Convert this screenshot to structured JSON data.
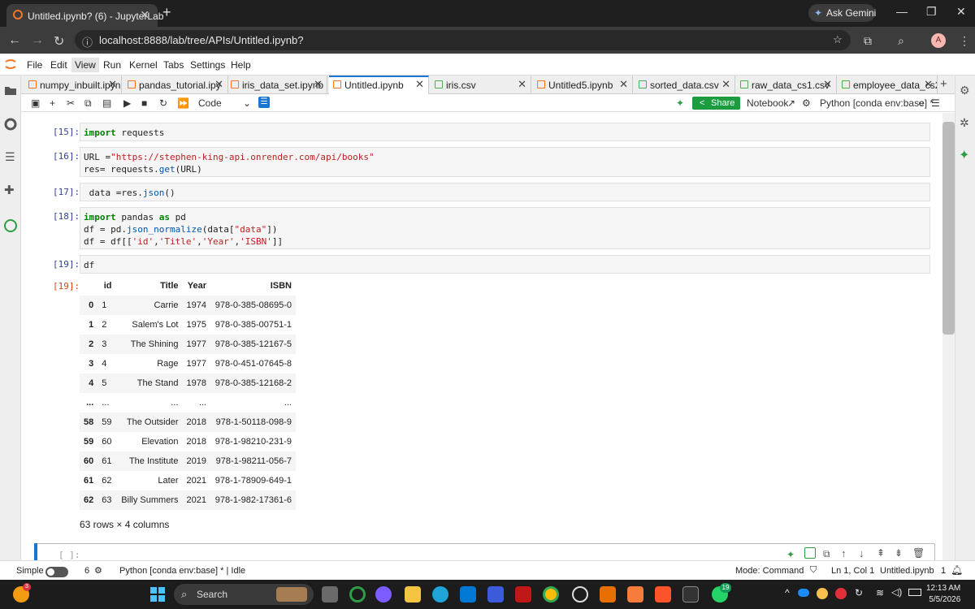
{
  "browser": {
    "tab_title": "Untitled.ipynb? (6) - JupyterLab",
    "new_tab_symbol": "+",
    "ask_gemini": "Ask Gemini",
    "url": "localhost:8888/lab/tree/APIs/Untitled.ipynb?",
    "profile_initial": "A"
  },
  "menu": [
    "File",
    "Edit",
    "View",
    "Run",
    "Kernel",
    "Tabs",
    "Settings",
    "Help"
  ],
  "menu_selected": "View",
  "notebook_tabs": [
    {
      "label": "numpy_inbuilt.ipyn",
      "type": "notebook",
      "active": false
    },
    {
      "label": "pandas_tutorial.ipy",
      "type": "notebook",
      "active": false
    },
    {
      "label": "iris_data_set.ipynb",
      "type": "notebook",
      "active": false
    },
    {
      "label": "Untitled.ipynb",
      "type": "notebook",
      "active": true
    },
    {
      "label": "iris.csv",
      "type": "csv",
      "active": false
    },
    {
      "label": "Untitled5.ipynb",
      "type": "notebook",
      "active": false
    },
    {
      "label": "sorted_data.csv",
      "type": "csv",
      "active": false
    },
    {
      "label": "raw_data_cs1.csv",
      "type": "csv",
      "active": false
    },
    {
      "label": "employee_data_cs2",
      "type": "csv",
      "active": false
    }
  ],
  "toolbar": {
    "cell_type": "Code",
    "share_label": "Share",
    "notebook_label": "Notebook",
    "kernel_label": "Python [conda env:base] *"
  },
  "cells": [
    {
      "prompt": "[15]:",
      "code": "import requests"
    },
    {
      "prompt": "[16]:",
      "code_line1": "URL =\"https://stephen-king-api.onrender.com/api/books\"",
      "code_line2": "res= requests.get(URL)"
    },
    {
      "prompt": "[17]:",
      "code": " data =res.json()"
    },
    {
      "prompt": "[18]:",
      "code_line1": "import pandas as pd",
      "code_line2": "df = pd.json_normalize(data[\"data\"])",
      "code_line3": "df = df[['id','Title','Year','ISBN']]"
    },
    {
      "prompt": "[19]:",
      "code": "df"
    }
  ],
  "output": {
    "prompt": "[19]:",
    "columns": [
      "id",
      "Title",
      "Year",
      "ISBN"
    ],
    "rows": [
      {
        "idx": "0",
        "id": "1",
        "title": "Carrie",
        "year": "1974",
        "isbn": "978-0-385-08695-0"
      },
      {
        "idx": "1",
        "id": "2",
        "title": "Salem's Lot",
        "year": "1975",
        "isbn": "978-0-385-00751-1"
      },
      {
        "idx": "2",
        "id": "3",
        "title": "The Shining",
        "year": "1977",
        "isbn": "978-0-385-12167-5"
      },
      {
        "idx": "3",
        "id": "4",
        "title": "Rage",
        "year": "1977",
        "isbn": "978-0-451-07645-8"
      },
      {
        "idx": "4",
        "id": "5",
        "title": "The Stand",
        "year": "1978",
        "isbn": "978-0-385-12168-2"
      },
      {
        "idx": "...",
        "id": "...",
        "title": "...",
        "year": "...",
        "isbn": "..."
      },
      {
        "idx": "58",
        "id": "59",
        "title": "The Outsider",
        "year": "2018",
        "isbn": "978-1-50118-098-9"
      },
      {
        "idx": "59",
        "id": "60",
        "title": "Elevation",
        "year": "2018",
        "isbn": "978-1-98210-231-9"
      },
      {
        "idx": "60",
        "id": "61",
        "title": "The Institute",
        "year": "2019",
        "isbn": "978-1-98211-056-7"
      },
      {
        "idx": "61",
        "id": "62",
        "title": "Later",
        "year": "2021",
        "isbn": "978-1-78909-649-1"
      },
      {
        "idx": "62",
        "id": "63",
        "title": "Billy Summers",
        "year": "2021",
        "isbn": "978-1-982-17361-6"
      }
    ],
    "row_count": "63 rows × 4 columns"
  },
  "empty_cell_prompt": "[ ]:",
  "status": {
    "mode_simple": "Simple",
    "terminals": "6",
    "kernel_status": "Python [conda env:base] * | Idle",
    "mode": "Mode: Command",
    "cursor": "Ln 1, Col 1",
    "file": "Untitled.ipynb",
    "notifications": "1"
  },
  "taskbar": {
    "search": "Search",
    "whatsapp_badge": "19",
    "time": "12:13 AM",
    "date": "5/5/2026",
    "weather_badge": "3"
  }
}
